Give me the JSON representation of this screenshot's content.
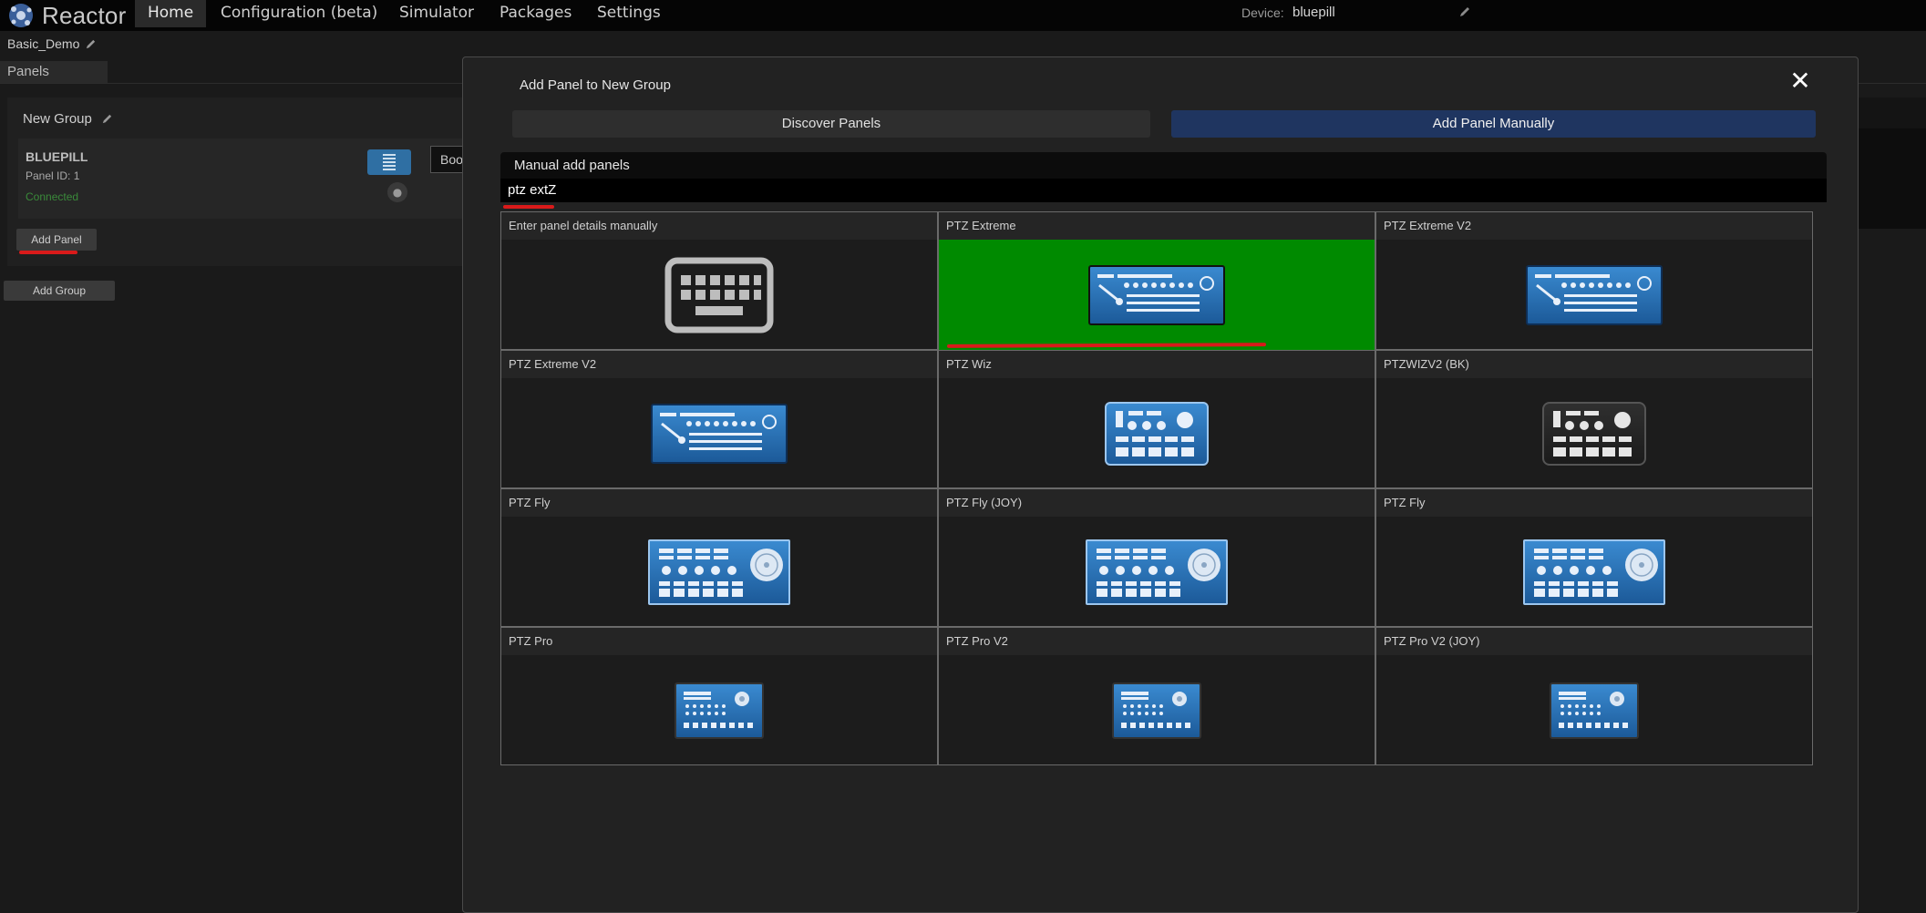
{
  "app": {
    "name": "Reactor"
  },
  "nav": {
    "items": [
      {
        "label": "Home",
        "active": true
      },
      {
        "label": "Configuration (beta)"
      },
      {
        "label": "Simulator"
      },
      {
        "label": "Packages"
      },
      {
        "label": "Settings"
      }
    ],
    "device_label": "Device:",
    "device_value": "bluepill"
  },
  "project": {
    "name": "Basic_Demo"
  },
  "tabs": {
    "panels": "Panels"
  },
  "background_group": {
    "title": "New Group",
    "panel": {
      "name": "BLUEPILL",
      "id_text": "Panel ID: 1",
      "status": "Connected",
      "boot_button": "Boot"
    },
    "add_panel": "Add Panel",
    "add_group": "Add Group"
  },
  "modal": {
    "title": "Add Panel to New Group",
    "close": "✕",
    "discover_label": "Discover Panels",
    "manual_label": "Add Panel Manually",
    "section_title": "Manual add panels",
    "search_value": "ptz extZ",
    "cells": [
      {
        "label": "Enter panel details manually",
        "icon": "keyboard-icon"
      },
      {
        "label": "PTZ Extreme",
        "icon": "ptz-extreme-device",
        "selected": true
      },
      {
        "label": "PTZ Extreme V2",
        "icon": "ptz-extreme-device"
      },
      {
        "label": "PTZ Extreme V2",
        "icon": "ptz-extreme-device"
      },
      {
        "label": "PTZ Wiz",
        "icon": "ptz-wiz-device"
      },
      {
        "label": "PTZWIZV2 (BK)",
        "icon": "ptz-wiz-dark-device"
      },
      {
        "label": "PTZ Fly",
        "icon": "ptz-fly-device"
      },
      {
        "label": "PTZ Fly (JOY)",
        "icon": "ptz-fly-device"
      },
      {
        "label": "PTZ Fly",
        "icon": "ptz-fly-device"
      },
      {
        "label": "PTZ Pro",
        "icon": "ptz-pro-device"
      },
      {
        "label": "PTZ Pro V2",
        "icon": "ptz-pro-device"
      },
      {
        "label": "PTZ Pro V2 (JOY)",
        "icon": "ptz-pro-device"
      }
    ]
  },
  "colors": {
    "selected_cell": "#008a00",
    "manual_button": "#1f3560",
    "annotation_red": "#d91a1a",
    "connected_text": "#3a8a3a"
  }
}
